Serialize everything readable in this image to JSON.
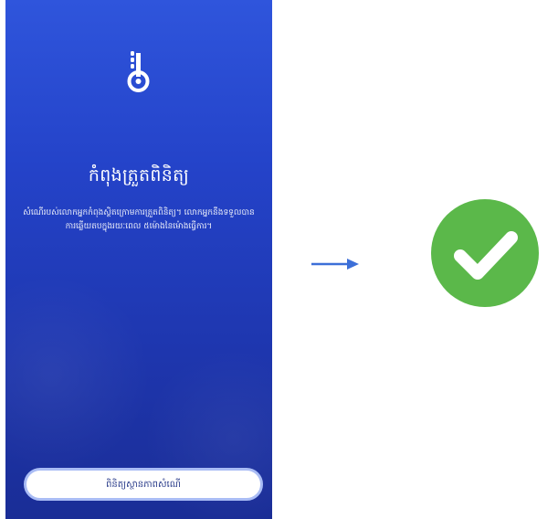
{
  "verification_screen": {
    "title": "កំពុងត្រួតពិនិត្យ",
    "description": "សំណើរបស់លោកអ្នកកំពុងស្ថិតក្រោមការត្រួតពិនិត្យ។ លោកអ្នកនឹងទទួលបានការឆ្លើយតបក្នុងរយៈពេល ៥ម៉ោងនៃម៉ោងធ្វើការ។",
    "check_status_label": "ពិនិត្យស្ថានភាពសំណើ",
    "logo_icon": "thermometer-logo-icon",
    "colors": {
      "background": "#2443c9",
      "button_border": "#a9bcf5",
      "button_text": "#2a3c8a"
    }
  },
  "transition": {
    "icon": "right-arrow-icon",
    "color": "#3c6fd8"
  },
  "result": {
    "icon": "success-check-icon",
    "color": "#5bb84a"
  }
}
